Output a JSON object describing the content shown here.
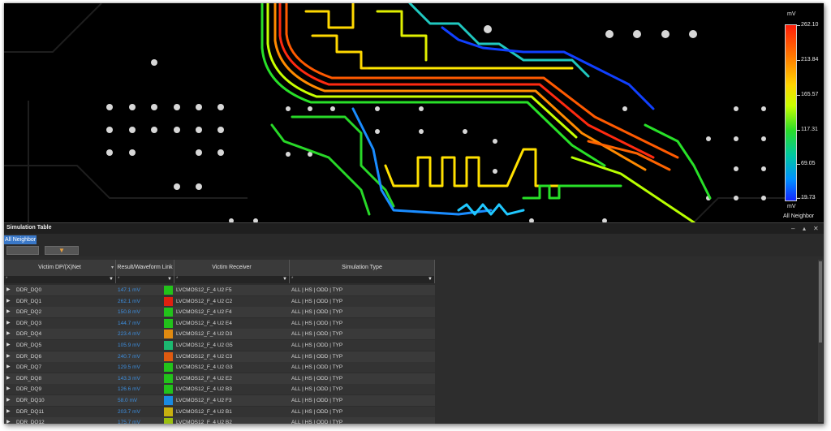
{
  "layout": {
    "scale": {
      "unit_top": "mV",
      "unit_bottom": "mV",
      "ticks": [
        "262.10",
        "213.84",
        "165.57",
        "117.31",
        "69.05",
        "19.73"
      ],
      "mode_label": "All Neighbor"
    }
  },
  "panel": {
    "title": "Simulation Table",
    "filter_chip": "All Neighbor",
    "columns": [
      "Victim DP/(X)Net",
      "Result/Waveform Link",
      "Victim Receiver",
      "Simulation Type"
    ],
    "filter_placeholder": "*",
    "rows": [
      {
        "net": "DDR_DQ0",
        "value": "147.1 mV",
        "color": "#22c21a",
        "receiver": "LVCMOS12_F_4 U2 F5",
        "type": "ALL | HS | ODD | TYP"
      },
      {
        "net": "DDR_DQ1",
        "value": "262.1 mV",
        "color": "#e02010",
        "receiver": "LVCMOS12_F_4 U2 C2",
        "type": "ALL | HS | ODD | TYP"
      },
      {
        "net": "DDR_DQ2",
        "value": "150.8 mV",
        "color": "#22c21a",
        "receiver": "LVCMOS12_F_4 U2 F4",
        "type": "ALL | HS | ODD | TYP"
      },
      {
        "net": "DDR_DQ3",
        "value": "144.7 mV",
        "color": "#22c21a",
        "receiver": "LVCMOS12_F_4 U2 E4",
        "type": "ALL | HS | ODD | TYP"
      },
      {
        "net": "DDR_DQ4",
        "value": "223.4 mV",
        "color": "#e08a10",
        "receiver": "LVCMOS12_F_4 U2 D3",
        "type": "ALL | HS | ODD | TYP"
      },
      {
        "net": "DDR_DQ5",
        "value": "105.9 mV",
        "color": "#1cb870",
        "receiver": "LVCMOS12_F_4 U2 G5",
        "type": "ALL | HS | ODD | TYP"
      },
      {
        "net": "DDR_DQ6",
        "value": "240.7 mV",
        "color": "#e05a10",
        "receiver": "LVCMOS12_F_4 U2 C3",
        "type": "ALL | HS | ODD | TYP"
      },
      {
        "net": "DDR_DQ7",
        "value": "129.5 mV",
        "color": "#22c21a",
        "receiver": "LVCMOS12_F_4 U2 G3",
        "type": "ALL | HS | ODD | TYP"
      },
      {
        "net": "DDR_DQ8",
        "value": "143.3 mV",
        "color": "#22c21a",
        "receiver": "LVCMOS12_F_4 U2 E2",
        "type": "ALL | HS | ODD | TYP"
      },
      {
        "net": "DDR_DQ9",
        "value": "126.6 mV",
        "color": "#22c21a",
        "receiver": "LVCMOS12_F_4 U2 B3",
        "type": "ALL | HS | ODD | TYP"
      },
      {
        "net": "DDR_DQ10",
        "value": "58.0 mV",
        "color": "#1a8ae0",
        "receiver": "LVCMOS12_F_4 U2 F3",
        "type": "ALL | HS | ODD | TYP"
      },
      {
        "net": "DDR_DQ11",
        "value": "203.7 mV",
        "color": "#c8b010",
        "receiver": "LVCMOS12_F_4 U2 B1",
        "type": "ALL | HS | ODD | TYP"
      },
      {
        "net": "DDR_DQ12",
        "value": "175.7 mV",
        "color": "#9cc010",
        "receiver": "LVCMOS12_F_4 U2 B2",
        "type": "ALL | HS | ODD | TYP"
      }
    ]
  }
}
